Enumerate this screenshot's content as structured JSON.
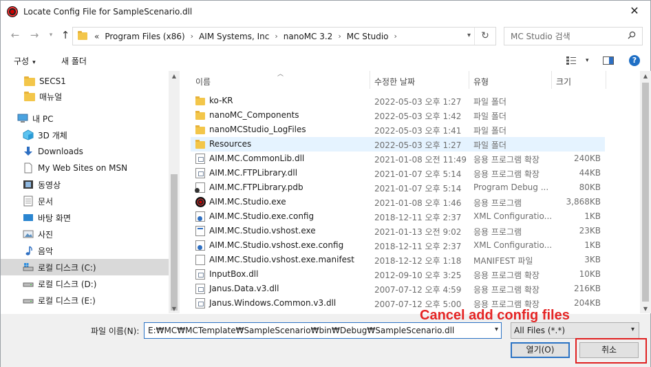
{
  "window": {
    "title": "Locate Config File for SampleScenario.dll",
    "close_glyph": "✕"
  },
  "nav": {
    "crumb_lead": "«",
    "breadcrumb": [
      "Program Files (x86)",
      "AIM Systems, Inc",
      "nanoMC 3.2",
      "MC Studio"
    ],
    "search_placeholder": "MC Studio 검색"
  },
  "toolbar": {
    "organize": "구성",
    "new_folder": "새 폴더"
  },
  "sidebar": {
    "items": [
      {
        "label": "SECS1",
        "icon": "folder-icon"
      },
      {
        "label": "매뉴얼",
        "icon": "folder-icon"
      },
      {
        "label": "내 PC",
        "icon": "pc-icon"
      },
      {
        "label": "3D 개체",
        "icon": "3d-objects-icon"
      },
      {
        "label": "Downloads",
        "icon": "download-icon"
      },
      {
        "label": "My Web Sites on MSN",
        "icon": "document-icon"
      },
      {
        "label": "동영상",
        "icon": "video-icon"
      },
      {
        "label": "문서",
        "icon": "documents-icon"
      },
      {
        "label": "바탕 화면",
        "icon": "desktop-icon"
      },
      {
        "label": "사진",
        "icon": "pictures-icon"
      },
      {
        "label": "음악",
        "icon": "music-icon"
      },
      {
        "label": "로컬 디스크 (C:)",
        "icon": "drive-c-icon"
      },
      {
        "label": "로컬 디스크 (D:)",
        "icon": "drive-icon"
      },
      {
        "label": "로컬 디스크 (E:)",
        "icon": "drive-icon"
      }
    ]
  },
  "columns": {
    "name": "이름",
    "date": "수정한 날짜",
    "type": "유형",
    "size": "크기"
  },
  "files": [
    {
      "name": "ko-KR",
      "date": "2022-05-03 오후 1:27",
      "type": "파일 폴더",
      "size": "",
      "icon": "folder"
    },
    {
      "name": "nanoMC_Components",
      "date": "2022-05-03 오후 1:42",
      "type": "파일 폴더",
      "size": "",
      "icon": "folder"
    },
    {
      "name": "nanoMCStudio_LogFiles",
      "date": "2022-05-03 오후 1:41",
      "type": "파일 폴더",
      "size": "",
      "icon": "folder"
    },
    {
      "name": "Resources",
      "date": "2022-05-03 오후 1:27",
      "type": "파일 폴더",
      "size": "",
      "icon": "folder"
    },
    {
      "name": "AIM.MC.CommonLib.dll",
      "date": "2021-01-08 오전 11:49",
      "type": "응용 프로그램 확장",
      "size": "240KB",
      "icon": "dll"
    },
    {
      "name": "AIM.MC.FTPLibrary.dll",
      "date": "2021-01-07 오후 5:14",
      "type": "응용 프로그램 확장",
      "size": "44KB",
      "icon": "dll"
    },
    {
      "name": "AIM.MC.FTPLibrary.pdb",
      "date": "2021-01-07 오후 5:14",
      "type": "Program Debug ...",
      "size": "80KB",
      "icon": "pdb"
    },
    {
      "name": "AIM.MC.Studio.exe",
      "date": "2021-01-08 오후 1:46",
      "type": "응용 프로그램",
      "size": "3,868KB",
      "icon": "exe"
    },
    {
      "name": "AIM.MC.Studio.exe.config",
      "date": "2018-12-11 오후 2:37",
      "type": "XML Configuratio...",
      "size": "1KB",
      "icon": "cfg"
    },
    {
      "name": "AIM.MC.Studio.vshost.exe",
      "date": "2021-01-13 오전 9:02",
      "type": "응용 프로그램",
      "size": "23KB",
      "icon": "app"
    },
    {
      "name": "AIM.MC.Studio.vshost.exe.config",
      "date": "2018-12-11 오후 2:37",
      "type": "XML Configuratio...",
      "size": "1KB",
      "icon": "cfg"
    },
    {
      "name": "AIM.MC.Studio.vshost.exe.manifest",
      "date": "2018-12-12 오후 1:18",
      "type": "MANIFEST 파일",
      "size": "3KB",
      "icon": "doc"
    },
    {
      "name": "InputBox.dll",
      "date": "2012-09-10 오후 3:25",
      "type": "응용 프로그램 확장",
      "size": "10KB",
      "icon": "dll"
    },
    {
      "name": "Janus.Data.v3.dll",
      "date": "2007-07-12 오후 4:59",
      "type": "응용 프로그램 확장",
      "size": "216KB",
      "icon": "dll"
    },
    {
      "name": "Janus.Windows.Common.v3.dll",
      "date": "2007-07-12 오후 5:00",
      "type": "응용 프로그램 확장",
      "size": "204KB",
      "icon": "dll"
    }
  ],
  "bottom": {
    "filename_label": "파일 이름(N):",
    "filename_value": "E:₩MC₩MCTemplate₩SampleScenario₩bin₩Debug₩SampleScenario.dll",
    "filetype_value": "All Files (*.*)",
    "open_button": "열기(O)",
    "cancel_button": "취소"
  },
  "annotation": {
    "text": "Cancel add config files",
    "color": "#e52424"
  }
}
